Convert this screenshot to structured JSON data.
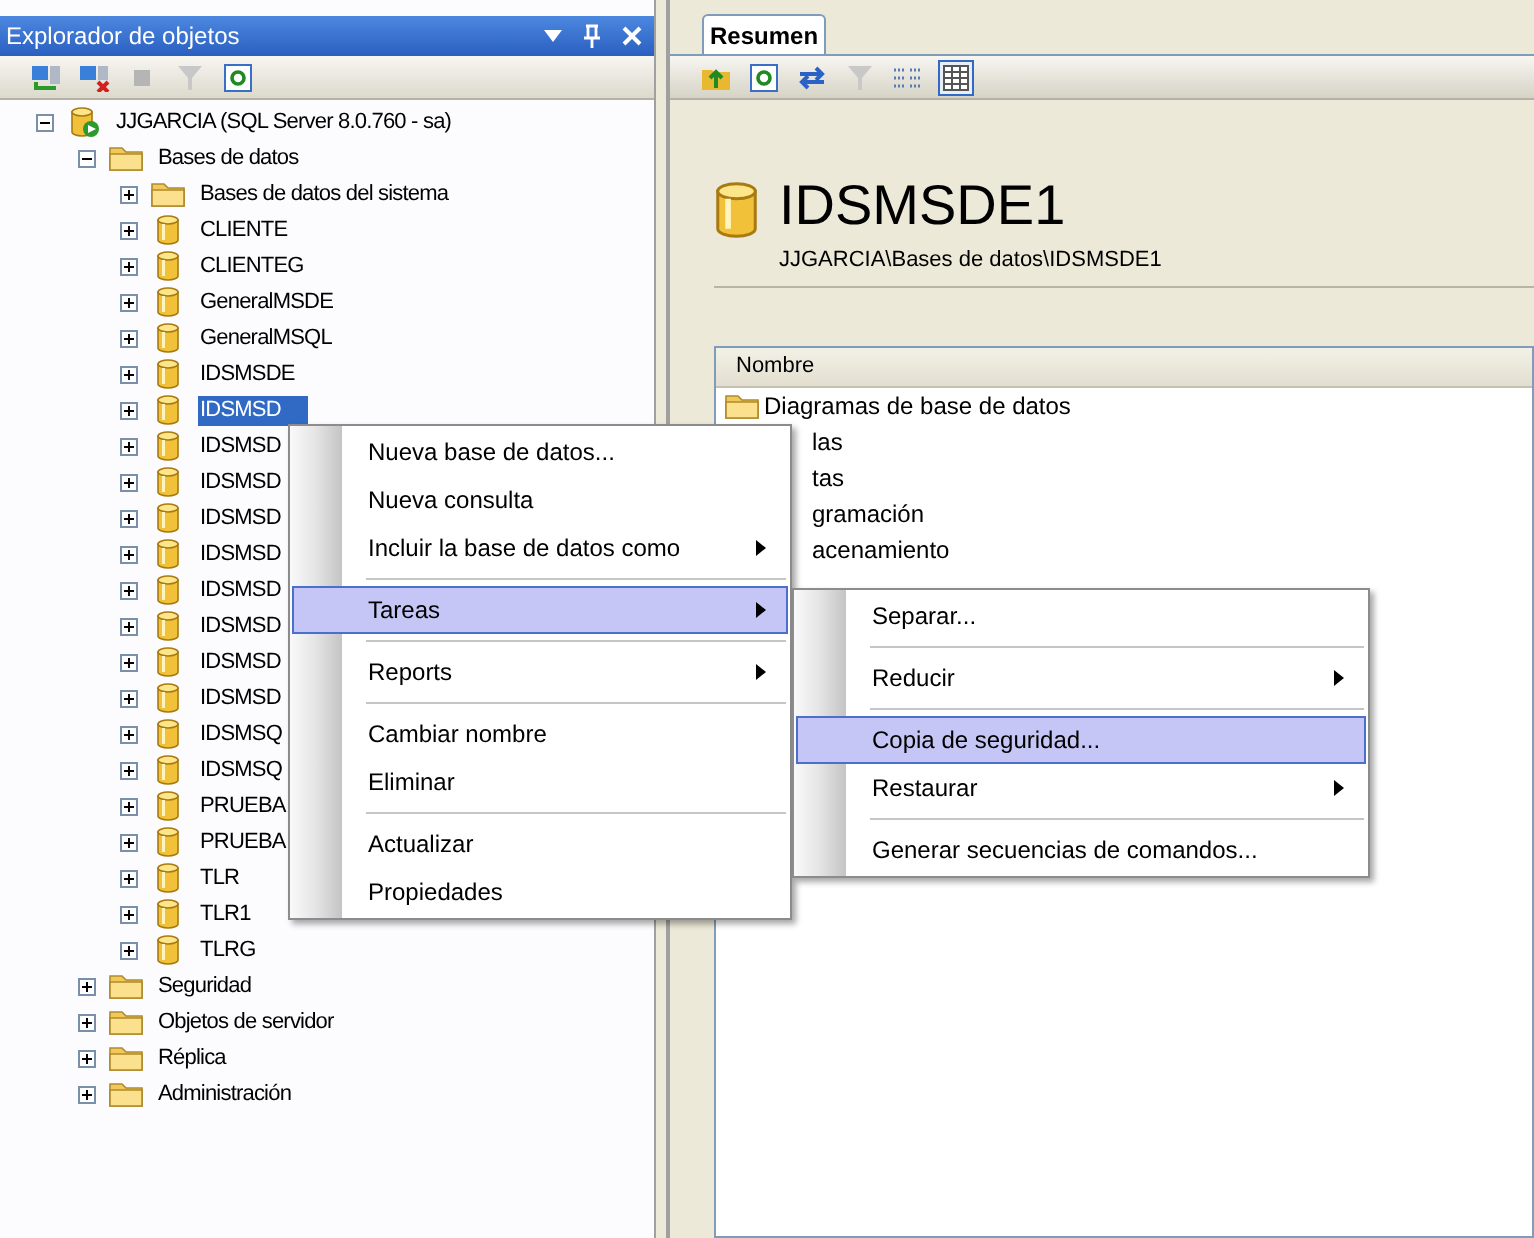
{
  "explorer": {
    "title": "Explorador de objetos",
    "tree": [
      {
        "label": "JJGARCIA (SQL Server 8.0.760 - sa)",
        "kind": "server",
        "expanded": true,
        "selected": false,
        "children": [
          {
            "label": "Bases de datos",
            "kind": "folder",
            "expanded": true,
            "selected": false,
            "children": [
              {
                "label": "Bases de datos del sistema",
                "kind": "folder",
                "expanded": false,
                "selected": false
              },
              {
                "label": "CLIENTE",
                "kind": "database",
                "expanded": false,
                "selected": false
              },
              {
                "label": "CLIENTEG",
                "kind": "database",
                "expanded": false,
                "selected": false
              },
              {
                "label": "GeneralMSDE",
                "kind": "database",
                "expanded": false,
                "selected": false
              },
              {
                "label": "GeneralMSQL",
                "kind": "database",
                "expanded": false,
                "selected": false
              },
              {
                "label": "IDSMSDE",
                "kind": "database",
                "expanded": false,
                "selected": false
              },
              {
                "label": "IDSMSD",
                "kind": "database",
                "expanded": false,
                "selected": true
              },
              {
                "label": "IDSMSD",
                "kind": "database",
                "expanded": false,
                "selected": false
              },
              {
                "label": "IDSMSD",
                "kind": "database",
                "expanded": false,
                "selected": false
              },
              {
                "label": "IDSMSD",
                "kind": "database",
                "expanded": false,
                "selected": false
              },
              {
                "label": "IDSMSD",
                "kind": "database",
                "expanded": false,
                "selected": false
              },
              {
                "label": "IDSMSD",
                "kind": "database",
                "expanded": false,
                "selected": false
              },
              {
                "label": "IDSMSD",
                "kind": "database",
                "expanded": false,
                "selected": false
              },
              {
                "label": "IDSMSD",
                "kind": "database",
                "expanded": false,
                "selected": false
              },
              {
                "label": "IDSMSD",
                "kind": "database",
                "expanded": false,
                "selected": false
              },
              {
                "label": "IDSMSQ",
                "kind": "database",
                "expanded": false,
                "selected": false
              },
              {
                "label": "IDSMSQ",
                "kind": "database",
                "expanded": false,
                "selected": false
              },
              {
                "label": "PRUEBA",
                "kind": "database",
                "expanded": false,
                "selected": false
              },
              {
                "label": "PRUEBA",
                "kind": "database",
                "expanded": false,
                "selected": false
              },
              {
                "label": "TLR",
                "kind": "database",
                "expanded": false,
                "selected": false
              },
              {
                "label": "TLR1",
                "kind": "database",
                "expanded": false,
                "selected": false
              },
              {
                "label": "TLRG",
                "kind": "database",
                "expanded": false,
                "selected": false
              }
            ]
          },
          {
            "label": "Seguridad",
            "kind": "folder",
            "expanded": false,
            "selected": false
          },
          {
            "label": "Objetos de servidor",
            "kind": "folder",
            "expanded": false,
            "selected": false
          },
          {
            "label": "Réplica",
            "kind": "folder",
            "expanded": false,
            "selected": false
          },
          {
            "label": "Administración",
            "kind": "folder",
            "expanded": false,
            "selected": false
          }
        ]
      }
    ]
  },
  "summary": {
    "tab": "Resumen",
    "title": "IDSMSDE1",
    "path": "JJGARCIA\\Bases de datos\\IDSMSDE1",
    "column": "Nombre",
    "items": [
      {
        "label": "Diagramas de base de datos",
        "kind": "full"
      },
      {
        "label": "las",
        "kind": "partial"
      },
      {
        "label": "tas",
        "kind": "partial"
      },
      {
        "label": "gramación",
        "kind": "partial"
      },
      {
        "label": "acenamiento",
        "kind": "partial"
      }
    ]
  },
  "context_menu": [
    {
      "kind": "command",
      "label": "Nueva base de datos...",
      "selected": false
    },
    {
      "kind": "command",
      "label": "Nueva consulta",
      "selected": false
    },
    {
      "kind": "submenu",
      "label": "Incluir la base de datos como",
      "selected": false
    },
    {
      "kind": "separator"
    },
    {
      "kind": "submenu",
      "label": "Tareas",
      "selected": true
    },
    {
      "kind": "separator"
    },
    {
      "kind": "submenu",
      "label": "Reports",
      "selected": false
    },
    {
      "kind": "separator"
    },
    {
      "kind": "command",
      "label": "Cambiar nombre",
      "selected": false
    },
    {
      "kind": "command",
      "label": "Eliminar",
      "selected": false
    },
    {
      "kind": "separator"
    },
    {
      "kind": "command",
      "label": "Actualizar",
      "selected": false
    },
    {
      "kind": "command",
      "label": "Propiedades",
      "selected": false
    }
  ],
  "submenu": [
    {
      "kind": "command",
      "label": "Separar...",
      "selected": false
    },
    {
      "kind": "separator"
    },
    {
      "kind": "submenu",
      "label": "Reducir",
      "selected": false
    },
    {
      "kind": "separator"
    },
    {
      "kind": "command",
      "label": "Copia de seguridad...",
      "selected": true
    },
    {
      "kind": "submenu",
      "label": "Restaurar",
      "selected": false
    },
    {
      "kind": "separator"
    },
    {
      "kind": "command",
      "label": "Generar secuencias de comandos...",
      "selected": false
    }
  ]
}
